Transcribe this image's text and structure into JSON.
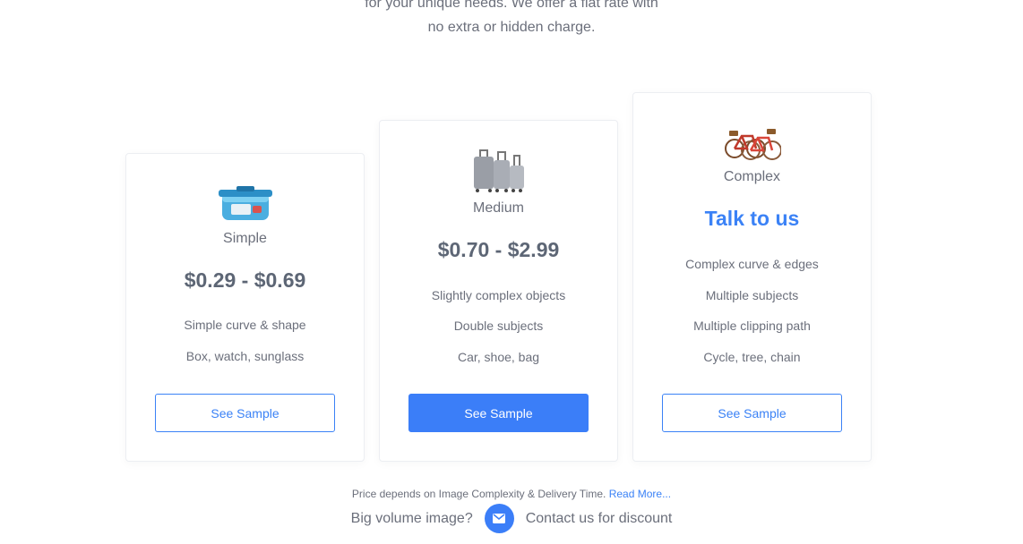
{
  "intro": {
    "line1": "for your unique needs. We offer a flat rate with",
    "line2": "no extra or hidden charge."
  },
  "plans": [
    {
      "name": "Simple",
      "price": "$0.29 - $0.69",
      "features": [
        "Simple curve & shape",
        "Box, watch, sunglass"
      ],
      "button": "See Sample",
      "icon": "food-container-icon"
    },
    {
      "name": "Medium",
      "price": "$0.70 - $2.99",
      "features": [
        "Slightly complex objects",
        "Double subjects",
        "Car, shoe, bag"
      ],
      "button": "See Sample",
      "icon": "luggage-icon"
    },
    {
      "name": "Complex",
      "price": "Talk to us",
      "features": [
        "Complex curve & edges",
        "Multiple subjects",
        "Multiple clipping path",
        "Cycle, tree, chain"
      ],
      "button": "See Sample",
      "icon": "bicycles-icon"
    }
  ],
  "footer": {
    "note": "Price depends on Image Complexity & Delivery Time.",
    "read_more": "Read More...",
    "volume_text": "Big volume image?",
    "contact_text": "Contact us for discount",
    "icon": "envelope-icon"
  },
  "colors": {
    "accent": "#3b7ef8",
    "text": "#6b6f7b",
    "price": "#5d6675"
  }
}
